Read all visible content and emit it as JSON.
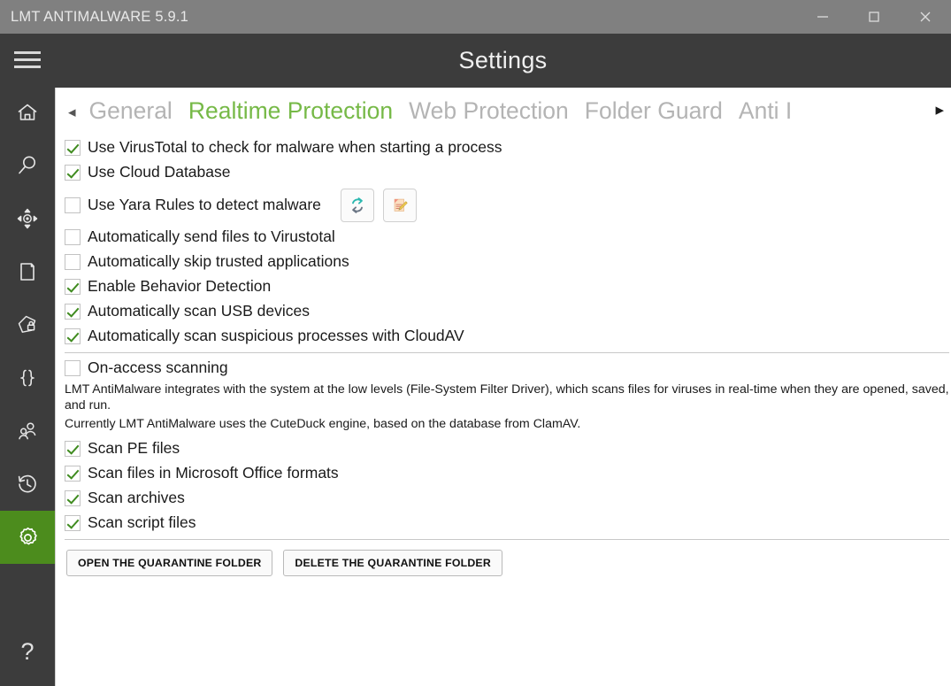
{
  "window": {
    "title": "LMT ANTIMALWARE 5.9.1",
    "minimize_label": "minimize",
    "maximize_label": "maximize",
    "close_label": "close",
    "titlebar_color": "#808080",
    "chrome_color": "#3c3c3c",
    "accent_color": "#4c8c1d"
  },
  "header": {
    "title": "Settings",
    "menu_label": "menu"
  },
  "sidebar": {
    "items": [
      {
        "name": "home",
        "label": "Home"
      },
      {
        "name": "scan",
        "label": "Scan"
      },
      {
        "name": "tools",
        "label": "Tools"
      },
      {
        "name": "reports",
        "label": "Reports"
      },
      {
        "name": "protection",
        "label": "Protection"
      },
      {
        "name": "scripts",
        "label": "Scripts"
      },
      {
        "name": "users",
        "label": "Users"
      },
      {
        "name": "history",
        "label": "History"
      },
      {
        "name": "settings",
        "label": "Settings"
      }
    ],
    "help_glyph": "?",
    "help_label": "Help"
  },
  "tabs": {
    "prev_arrow": "◂",
    "next_arrow": "▸",
    "items": [
      {
        "label": "General",
        "active": false
      },
      {
        "label": "Realtime Protection",
        "active": true
      },
      {
        "label": "Web Protection",
        "active": false
      },
      {
        "label": "Folder Guard",
        "active": false
      },
      {
        "label": "Anti I",
        "active": false
      }
    ],
    "active_color": "#76b947",
    "inactive_color": "#b4b4b4"
  },
  "options": {
    "group_a": [
      {
        "label": "Use VirusTotal to check for malware when starting a process",
        "checked": true
      },
      {
        "label": "Use Cloud Database",
        "checked": true
      }
    ],
    "yara": {
      "label": "Use Yara Rules to detect malware",
      "checked": false,
      "refresh_button_label": "Update Yara rules",
      "edit_button_label": "Edit Yara rules"
    },
    "group_b": [
      {
        "label": "Automatically send files to Virustotal",
        "checked": false
      },
      {
        "label": "Automatically skip trusted applications",
        "checked": false
      },
      {
        "label": "Enable Behavior Detection",
        "checked": true
      },
      {
        "label": "Automatically scan USB devices",
        "checked": true
      },
      {
        "label": "Automatically scan suspicious processes with CloudAV",
        "checked": true
      }
    ],
    "on_access": {
      "label": "On-access scanning",
      "checked": false
    },
    "description_line_1": "LMT AntiMalware integrates with the system at the low levels (File-System Filter Driver), which scans files for viruses in real-time when they are opened, saved, and run.",
    "description_line_2": "Currently LMT AntiMalware uses the CuteDuck engine, based on the database from ClamAV.",
    "group_c": [
      {
        "label": "Scan PE files",
        "checked": true
      },
      {
        "label": "Scan files in Microsoft Office formats",
        "checked": true
      },
      {
        "label": "Scan archives",
        "checked": true
      },
      {
        "label": "Scan script files",
        "checked": true
      }
    ]
  },
  "buttons": {
    "open_quarantine": "OPEN THE QUARANTINE FOLDER",
    "delete_quarantine": "DELETE THE QUARANTINE FOLDER"
  }
}
